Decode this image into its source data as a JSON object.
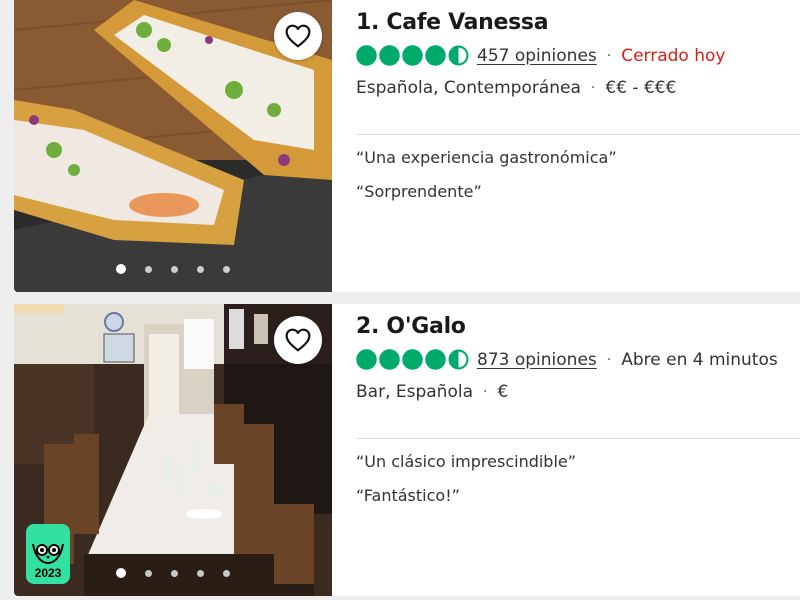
{
  "listings": [
    {
      "title": "1. Cafe Vanessa",
      "reviews": "457 opiniones",
      "status": "Cerrado hoy",
      "status_color": "#d91e18",
      "cuisine": "Española, Contemporánea",
      "price": "€€ - €€€",
      "quotes": [
        "“Una experiencia gastronómica”",
        "“Sorprendente”"
      ],
      "rating_bubbles": 4.5
    },
    {
      "title": "2. O'Galo",
      "reviews": "873 opiniones",
      "status": "Abre en 4 minutos",
      "status_color": "#333333",
      "cuisine": "Bar, Española",
      "price": "€",
      "quotes": [
        "“Un clásico imprescindible”",
        "“Fantástico!”"
      ],
      "rating_bubbles": 4.5,
      "badge_year": "2023"
    }
  ],
  "icons": {
    "favorite": "heart-outline-icon",
    "rating": "rating-bubble-icon",
    "award": "travelers-choice-owl-icon"
  },
  "colors": {
    "rating": "#00aa6c",
    "badge": "#34e0a1",
    "closed": "#d91e18"
  }
}
